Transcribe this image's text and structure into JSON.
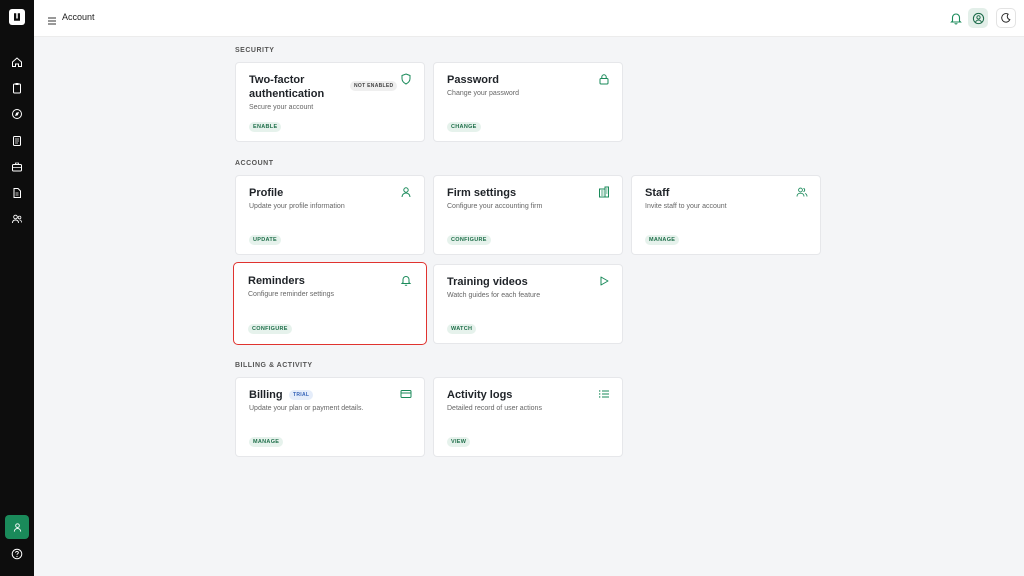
{
  "header": {
    "title": "Account"
  },
  "icons": {
    "sidebar": [
      "logo-icon",
      "home-icon",
      "clipboard-icon",
      "compass-icon",
      "document-icon",
      "briefcase-icon",
      "file-icon",
      "users-icon",
      "user-icon",
      "help-icon"
    ],
    "topbar": [
      "menu-icon",
      "bell-icon",
      "user-circle-icon",
      "moon-icon"
    ]
  },
  "colors": {
    "accent": "#1a8a5a",
    "highlight": "#e0332f",
    "sidebar": "#0d0d0d"
  },
  "sections": {
    "security": "SECURITY",
    "account": "ACCOUNT",
    "billing": "BILLING & ACTIVITY"
  },
  "cards": {
    "two_factor": {
      "title": "Two-factor authentication",
      "desc": "Secure your account",
      "badge": "NOT ENABLED",
      "action": "ENABLE",
      "icon": "shield-icon"
    },
    "password": {
      "title": "Password",
      "desc": "Change your password",
      "action": "CHANGE",
      "icon": "lock-icon"
    },
    "profile": {
      "title": "Profile",
      "desc": "Update your profile information",
      "action": "UPDATE",
      "icon": "user-icon"
    },
    "firm_settings": {
      "title": "Firm settings",
      "desc": "Configure your accounting firm",
      "action": "CONFIGURE",
      "icon": "building-icon"
    },
    "staff": {
      "title": "Staff",
      "desc": "Invite staff to your account",
      "action": "MANAGE",
      "icon": "users-icon"
    },
    "reminders": {
      "title": "Reminders",
      "desc": "Configure reminder settings",
      "action": "CONFIGURE",
      "icon": "bell-icon"
    },
    "training_videos": {
      "title": "Training videos",
      "desc": "Watch guides for each feature",
      "action": "WATCH",
      "icon": "play-icon"
    },
    "billing": {
      "title": "Billing",
      "desc": "Update your plan or payment details.",
      "badge": "TRIAL",
      "action": "MANAGE",
      "icon": "credit-card-icon"
    },
    "activity_logs": {
      "title": "Activity logs",
      "desc": "Detailed record of user actions",
      "action": "VIEW",
      "icon": "list-icon"
    }
  }
}
